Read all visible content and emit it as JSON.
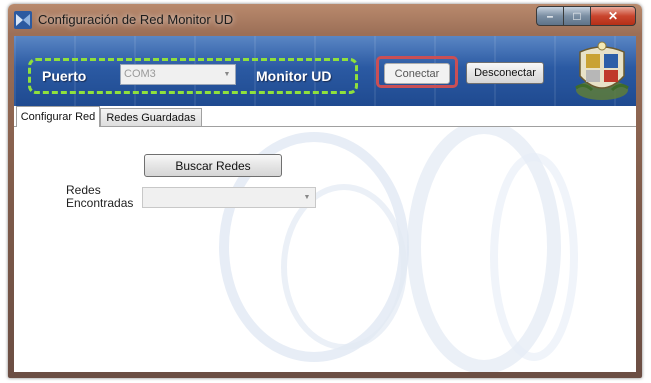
{
  "window": {
    "title": "Configuración de Red Monitor UD",
    "caption_buttons": {
      "minimize_icon": "minimize-icon",
      "maximize_icon": "maximize-icon",
      "close_icon": "close-icon"
    }
  },
  "header": {
    "port_label": "Puerto",
    "port_value": "COM3",
    "monitor_label": "Monitor UD",
    "connect_label": "Conectar",
    "disconnect_label": "Desconectar",
    "crest_icon": "university-crest-icon",
    "highlight_colors": {
      "dashed_box": "#8fe03c",
      "connect_box": "#c94f55"
    }
  },
  "tabs": [
    {
      "label": "Configurar Red",
      "active": true
    },
    {
      "label": "Redes Guardadas",
      "active": false
    }
  ],
  "configure": {
    "search_button_label": "Buscar Redes",
    "found_label_line1": "Redes",
    "found_label_line2": "Encontradas",
    "found_value": ""
  }
}
